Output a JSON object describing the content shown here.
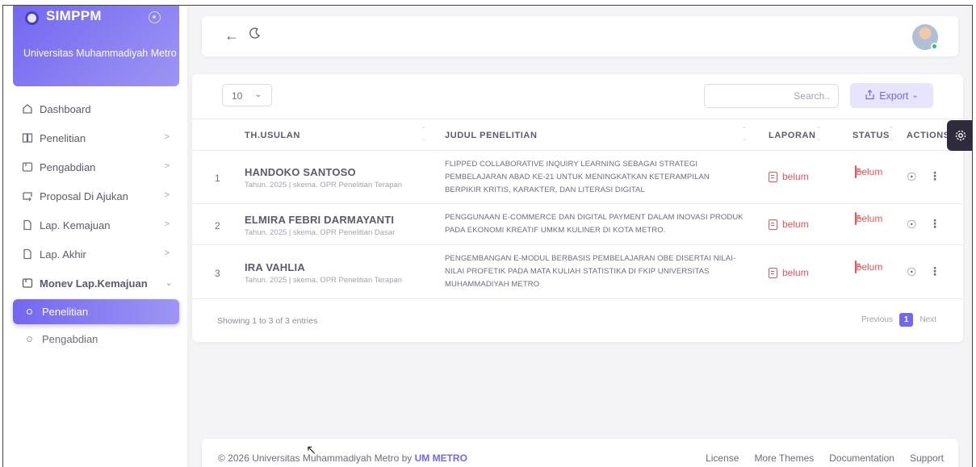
{
  "brand": {
    "name": "SIMPPM",
    "subtitle": "Universitas Muhammadiyah Metro"
  },
  "sidebar": {
    "items": [
      {
        "label": "Dashboard",
        "icon": "home-icon"
      },
      {
        "label": "Penelitian",
        "icon": "book-icon"
      },
      {
        "label": "Pengabdian",
        "icon": "calendar-icon"
      },
      {
        "label": "Proposal Di Ajukan",
        "icon": "login-icon"
      },
      {
        "label": "Lap. Kemajuan",
        "icon": "file-icon"
      },
      {
        "label": "Lap. Akhir",
        "icon": "file-icon"
      },
      {
        "label": "Monev Lap.Kemajuan",
        "icon": "calendar-icon"
      },
      {
        "label": "Penelitian",
        "icon": "bullet-icon"
      },
      {
        "label": "Pengabdian",
        "icon": "bullet-icon"
      }
    ]
  },
  "table": {
    "page_length": "10",
    "search_placeholder": "Search..",
    "export_label": "Export",
    "columns": [
      "TH.USULAN",
      "JUDUL PENELITIAN",
      "LAPORAN",
      "STATUS",
      "ACTIONS"
    ],
    "rows": [
      {
        "no": "1",
        "name": "HANDOKO SANTOSO",
        "meta": "Tahun. 2025 | skema. OPR Penelitian Terapan",
        "judul": "FLIPPED COLLABORATIVE INQUIRY LEARNING SEBAGAI STRATEGI PEMBELAJARAN ABAD KE-21 UNTUK MENINGKATKAN KETERAMPILAN BERPIKIR KRITIS, KARAKTER, DAN LITERASI DIGITAL",
        "laporan": "belum",
        "status": "belum"
      },
      {
        "no": "2",
        "name": "ELMIRA FEBRI DARMAYANTI",
        "meta": "Tahun. 2025 | skema. OPR Penelitian Dasar",
        "judul": "PENGGUNAAN E-COMMERCE DAN DIGITAL PAYMENT DALAM INOVASI PRODUK PADA EKONOMI KREATIF UMKM KULINER DI KOTA METRO.",
        "laporan": "belum",
        "status": "belum"
      },
      {
        "no": "3",
        "name": "IRA VAHLIA",
        "meta": "Tahun. 2025 | skema. OPR Penelitian Terapan",
        "judul": "PENGEMBANGAN E-MODUL BERBASIS PEMBELAJARAN OBE DISERTAI NILAI-NILAI PROFETIK PADA MATA KULIAH STATISTIKA DI FKIP UNIVERSITAS MUHAMMADIYAH METRO",
        "laporan": "belum",
        "status": "belum"
      }
    ],
    "showing": "Showing 1 to 3 of 3 entries",
    "pager": {
      "previous": "Previous",
      "current": "1",
      "next": "Next"
    }
  },
  "footer": {
    "copyright": "© 2026 Universitas Muhammadiyah Metro by ",
    "brand_link": "UM METRO",
    "links": [
      "License",
      "More Themes",
      "Documentation",
      "Support"
    ]
  },
  "colors": {
    "primary": "#7367f0",
    "danger": "#ea5455",
    "success": "#28c76f"
  }
}
